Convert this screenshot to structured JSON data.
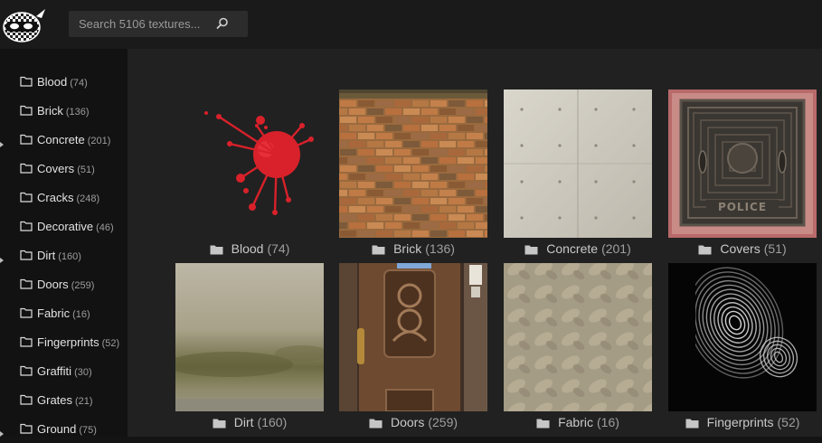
{
  "search": {
    "placeholder": "Search 5106 textures..."
  },
  "sidebar": {
    "items": [
      {
        "label": "Blood",
        "count": "(74)",
        "expandable": false
      },
      {
        "label": "Brick",
        "count": "(136)",
        "expandable": false
      },
      {
        "label": "Concrete",
        "count": "(201)",
        "expandable": true
      },
      {
        "label": "Covers",
        "count": "(51)",
        "expandable": false
      },
      {
        "label": "Cracks",
        "count": "(248)",
        "expandable": false
      },
      {
        "label": "Decorative",
        "count": "(46)",
        "expandable": false
      },
      {
        "label": "Dirt",
        "count": "(160)",
        "expandable": true
      },
      {
        "label": "Doors",
        "count": "(259)",
        "expandable": false
      },
      {
        "label": "Fabric",
        "count": "(16)",
        "expandable": false
      },
      {
        "label": "Fingerprints",
        "count": "(52)",
        "expandable": false
      },
      {
        "label": "Graffiti",
        "count": "(30)",
        "expandable": false
      },
      {
        "label": "Grates",
        "count": "(21)",
        "expandable": false
      },
      {
        "label": "Ground",
        "count": "(75)",
        "expandable": true
      }
    ]
  },
  "grid": {
    "tiles": [
      {
        "label": "Blood",
        "count": "(74)",
        "image": "blood-splatter"
      },
      {
        "label": "Brick",
        "count": "(136)",
        "image": "brick-wall"
      },
      {
        "label": "Concrete",
        "count": "(201)",
        "image": "concrete-wall"
      },
      {
        "label": "Covers",
        "count": "(51)",
        "image": "manhole-cover"
      },
      {
        "label": "Dirt",
        "count": "(160)",
        "image": "dirty-wall"
      },
      {
        "label": "Doors",
        "count": "(259)",
        "image": "wooden-door"
      },
      {
        "label": "Fabric",
        "count": "(16)",
        "image": "floral-fabric"
      },
      {
        "label": "Fingerprints",
        "count": "(52)",
        "image": "fingerprint"
      }
    ]
  },
  "manhole_text": "POLICE",
  "colors": {
    "accent": "#d8212a",
    "topbar": "#1a1a1a",
    "main_bg": "#212121",
    "sidebar_bg": "#121212"
  }
}
